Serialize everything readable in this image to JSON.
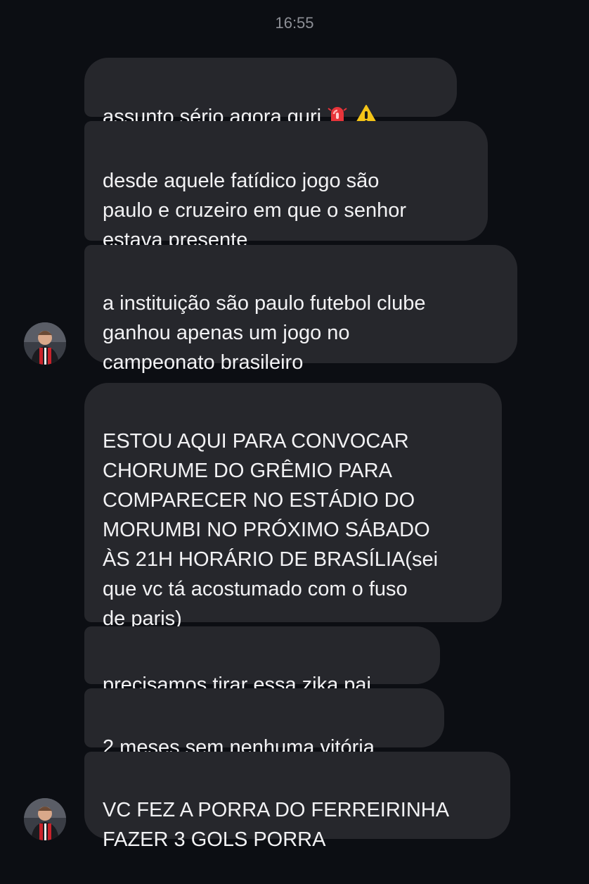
{
  "timestamp": "16:55",
  "messages": [
    {
      "text": "assunto sério agora guri",
      "emojis": [
        "siren-emoji",
        "warning-emoji"
      ]
    },
    {
      "text": "desde aquele fatídico jogo são\npaulo e cruzeiro em que o senhor\nestava presente"
    },
    {
      "text": "a instituição são paulo futebol clube\nganhou apenas um jogo no\ncampeonato brasileiro"
    },
    {
      "text": "ESTOU AQUI PARA CONVOCAR\nCHORUME DO GRÊMIO PARA\nCOMPARECER NO ESTÁDIO DO\nMORUMBI NO PRÓXIMO SÁBADO\nÀS 21H HORÁRIO DE BRASÍLIA(sei\nque vc tá acostumado com o fuso\nde paris)"
    },
    {
      "text": "precisamos tirar essa zika pai"
    },
    {
      "text": "2 meses sem nenhuma vitória"
    },
    {
      "text": "VC FEZ A PORRA DO FERREIRINHA\nFAZER 3 GOLS PORRA"
    }
  ],
  "colors": {
    "background": "#0c0e13",
    "bubble": "#26272c",
    "text": "#f2f2f4",
    "timestamp": "#8d8f96"
  }
}
